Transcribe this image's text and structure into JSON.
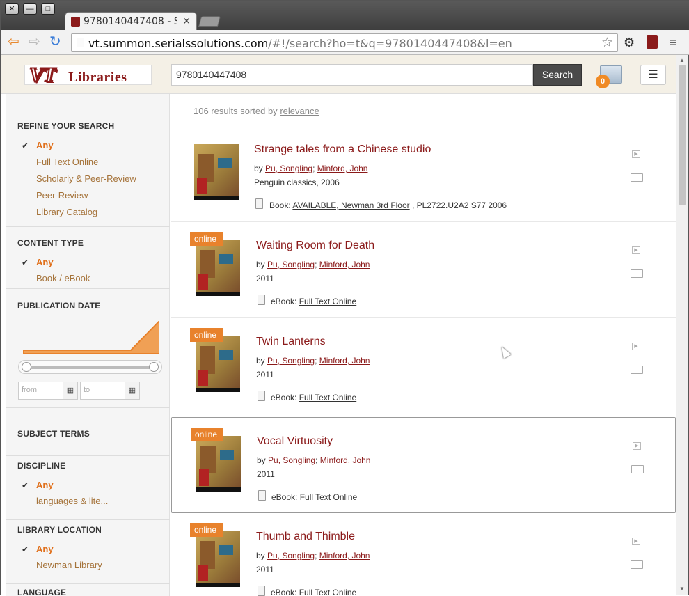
{
  "browser": {
    "tab_title": "9780140447408 - Sou",
    "url_host": "vt.summon.serialssolutions.com",
    "url_path": "/#!/search?ho=t&q=9780140447408&l=en"
  },
  "header": {
    "logo_vt": "VT",
    "logo_libraries": "Libraries",
    "search_value": "9780140447408",
    "search_button": "Search",
    "folder_count": "0"
  },
  "sidebar": {
    "refine": {
      "heading": "REFINE YOUR SEARCH",
      "items": [
        "Any",
        "Full Text Online",
        "Scholarly & Peer-Review",
        "Peer-Review",
        "Library Catalog"
      ]
    },
    "content_type": {
      "heading": "CONTENT TYPE",
      "items": [
        "Any",
        "Book / eBook"
      ]
    },
    "publication_date": {
      "heading": "PUBLICATION DATE",
      "from_placeholder": "from",
      "to_placeholder": "to"
    },
    "subject_terms": {
      "heading": "SUBJECT TERMS"
    },
    "discipline": {
      "heading": "DISCIPLINE",
      "items": [
        "Any",
        "languages & lite..."
      ]
    },
    "library_location": {
      "heading": "LIBRARY LOCATION",
      "items": [
        "Any",
        "Newman Library"
      ]
    },
    "language": {
      "heading": "LANGUAGE"
    }
  },
  "results": {
    "summary_prefix": "106 results sorted by",
    "sort": "relevance",
    "items": [
      {
        "title": "Strange tales from a Chinese studio",
        "by": "by",
        "author1": "Pu, Songling",
        "sep": ";",
        "author2": "Minford, John",
        "pub": "Penguin classics, 2006",
        "format": "Book:",
        "availability": "AVAILABLE, Newman 3rd Floor",
        "callno": ", PL2722.U2A2 S77 2006",
        "badge": ""
      },
      {
        "title": "Waiting Room for Death",
        "by": "by",
        "author1": "Pu, Songling",
        "sep": ";",
        "author2": "Minford, John",
        "pub": "2011",
        "format": "eBook:",
        "availability": "Full Text Online",
        "callno": "",
        "badge": "online"
      },
      {
        "title": "Twin Lanterns",
        "by": "by",
        "author1": "Pu, Songling",
        "sep": ";",
        "author2": "Minford, John",
        "pub": "2011",
        "format": "eBook:",
        "availability": "Full Text Online",
        "callno": "",
        "badge": "online"
      },
      {
        "title": "Vocal Virtuosity",
        "by": "by",
        "author1": "Pu, Songling",
        "sep": ";",
        "author2": "Minford, John",
        "pub": "2011",
        "format": "eBook:",
        "availability": "Full Text Online",
        "callno": "",
        "badge": "online"
      },
      {
        "title": "Thumb and Thimble",
        "by": "by",
        "author1": "Pu, Songling",
        "sep": ";",
        "author2": "Minford, John",
        "pub": "2011",
        "format": "eBook:",
        "availability": "Full Text Online",
        "callno": "",
        "badge": "online"
      }
    ]
  },
  "colors": {
    "accent": "#e06f1a",
    "title_red": "#8b1a1a",
    "facet_link": "#a5733a"
  }
}
